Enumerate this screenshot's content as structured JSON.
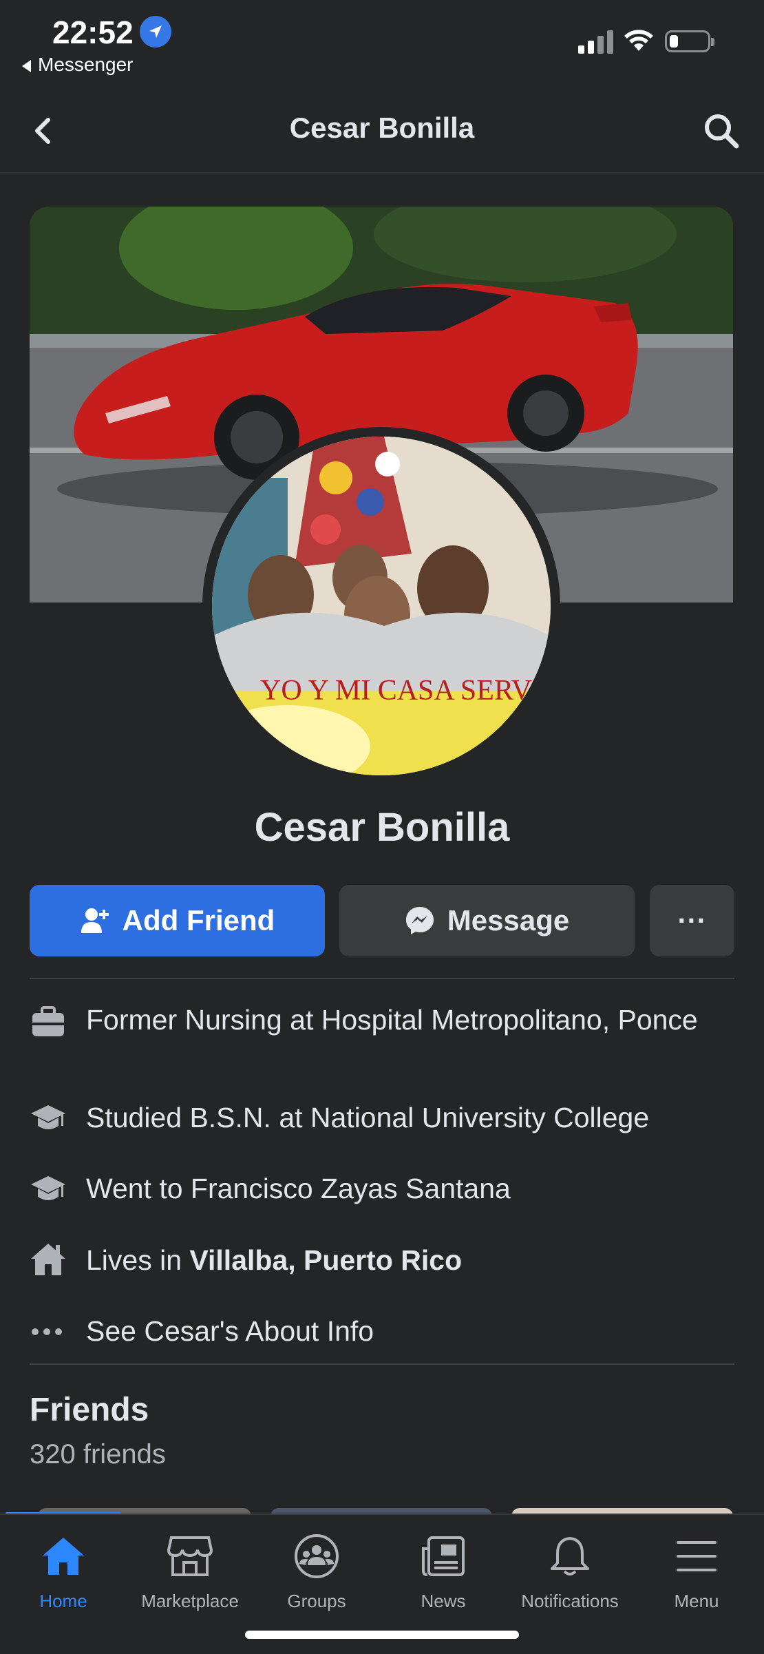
{
  "status_bar": {
    "time": "22:52",
    "back_app": "Messenger"
  },
  "header": {
    "title": "Cesar Bonilla"
  },
  "profile": {
    "name": "Cesar Bonilla",
    "avatar_caption": "YO Y MI CASA SERVIREMOS A Jehová"
  },
  "actions": {
    "add_friend": "Add Friend",
    "message": "Message",
    "more": "···"
  },
  "info": [
    {
      "icon": "briefcase-icon",
      "text": "Former Nursing at Hospital Metropolitano, Ponce"
    },
    {
      "icon": "graduation-cap-icon",
      "text": "Studied B.S.N. at National University College"
    },
    {
      "icon": "graduation-cap-icon",
      "text": "Went to Francisco Zayas Santana"
    },
    {
      "icon": "house-icon",
      "prefix": "Lives in ",
      "bold": "Villalba, Puerto Rico"
    },
    {
      "icon": "more-dots-icon",
      "text": "See Cesar's About Info"
    }
  ],
  "friends": {
    "title": "Friends",
    "count": "320 friends"
  },
  "tabs": [
    {
      "label": "Home",
      "icon": "home-icon",
      "active": true
    },
    {
      "label": "Marketplace",
      "icon": "marketplace-icon",
      "active": false
    },
    {
      "label": "Groups",
      "icon": "groups-icon",
      "active": false
    },
    {
      "label": "News",
      "icon": "news-icon",
      "active": false
    },
    {
      "label": "Notifications",
      "icon": "bell-icon",
      "active": false
    },
    {
      "label": "Menu",
      "icon": "menu-icon",
      "active": false
    }
  ],
  "colors": {
    "background": "#242526",
    "accent": "#2d88ff",
    "primary_button": "#2d6fe0",
    "secondary_button": "#3a3b3c"
  }
}
